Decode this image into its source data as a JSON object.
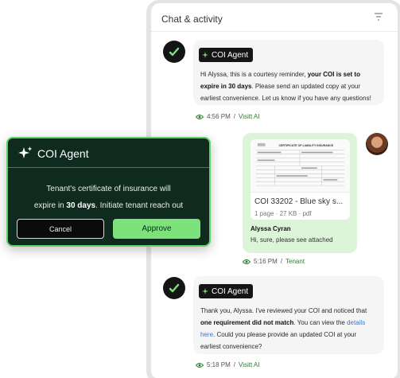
{
  "panel": {
    "title": "Chat & activity",
    "filter_icon": "filter-lines-icon"
  },
  "messages": [
    {
      "sender": "agent",
      "tag": "COI Agent",
      "text_parts": [
        "Hi Alyssa, this is a courtesy reminder, ",
        "your COI is set to expire in 30 days",
        ". Please send an updated copy at your earliest convenience. Let us know if you have any questions!"
      ],
      "time": "4:56 PM",
      "source": "Visitt AI"
    },
    {
      "sender": "user",
      "attachment": {
        "name": "COI 33202 - Blue sky s...",
        "meta": "1 page · 27 KB · pdf",
        "doc_heading": "CERTIFICATE OF LIABILITY INSURANCE"
      },
      "name": "Alyssa Cyran",
      "text": "Hi, sure, please see attached",
      "time": "5:16 PM",
      "source": "Tenant"
    },
    {
      "sender": "agent",
      "tag": "COI Agent",
      "text_parts": [
        "Thank you, Alyssa. I've reviewed your COI and noticed that ",
        "one requirement did not match",
        ". You can view the ",
        "details here",
        ". Could you please provide an updated COI at your earliest convenience?"
      ],
      "time": "5:18 PM",
      "source": "Visitt AI"
    }
  ],
  "popup": {
    "title": "COI Agent",
    "body_line1": "Tenant's certificate of insurance will",
    "body_line2_pre": "expire in ",
    "body_line2_bold": "30 days",
    "body_line2_post": ". Initiate tenant reach out",
    "cancel_label": "Cancel",
    "approve_label": "Approve"
  },
  "colors": {
    "popup_bg": "#0f2a1f",
    "accent_green": "#7ee27b",
    "user_bubble": "#dcf5d9",
    "link_blue": "#3a74d8"
  }
}
